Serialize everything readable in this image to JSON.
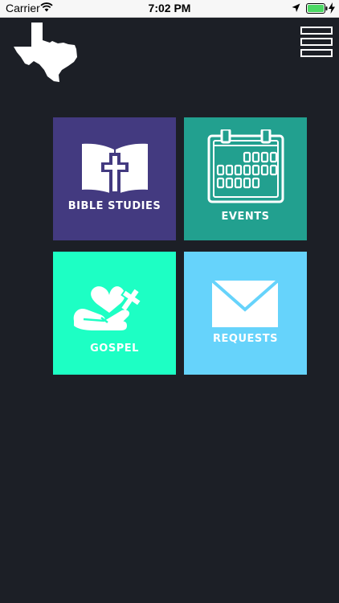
{
  "status_bar": {
    "carrier": "Carrier",
    "time": "7:02 PM",
    "icons": [
      "wifi-icon",
      "location-arrow-icon",
      "battery-icon",
      "charging-bolt-icon"
    ]
  },
  "header": {
    "logo_icon": "texas-state-icon",
    "menu_icon": "hamburger-menu-icon"
  },
  "tiles": [
    {
      "label": "BIBLE STUDIES",
      "icon": "bible-cross-icon",
      "color": "#433a80"
    },
    {
      "label": "EVENTS",
      "icon": "calendar-icon",
      "color": "#22a08f"
    },
    {
      "label": "GOSPEL",
      "icon": "hand-heart-cross-icon",
      "color": "#1dffc4"
    },
    {
      "label": "REQUESTS",
      "icon": "envelope-icon",
      "color": "#66d3fb"
    }
  ],
  "colors": {
    "background": "#1c1f26",
    "status_bar": "#f7f7f7",
    "battery_green": "#4cd964"
  }
}
